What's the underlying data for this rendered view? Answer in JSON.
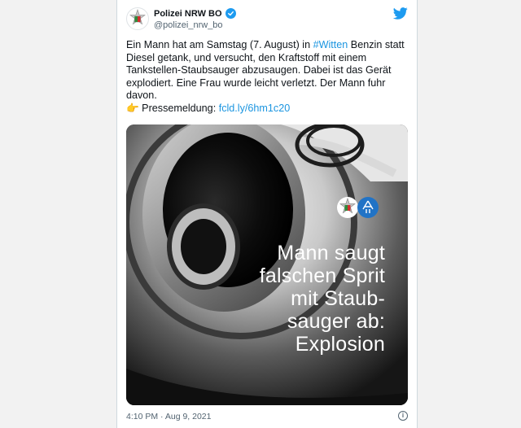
{
  "author": {
    "name": "Polizei NRW BO",
    "handle": "@polizei_nrw_bo"
  },
  "tweet": {
    "text_1": "Ein Mann hat am Samstag (7. August) in ",
    "hashtag": "#Witten",
    "text_2": " Benzin statt Diesel getank, und versucht, den Kraftstoff mit einem Tankstellen-Staubsauger abzusaugen. Dabei ist das Gerät explodiert. Eine Frau wurde leicht verletzt. Der Mann fuhr davon.",
    "pointer_emoji": "👉",
    "press_label": " Pressemeldung: ",
    "press_link": "fcld.ly/6hm1c20"
  },
  "media": {
    "title_lines": [
      "Mann saugt",
      "falschen Sprit",
      "mit Staub-",
      "sauger ab:",
      "Explosion"
    ]
  },
  "footer": {
    "timestamp": "4:10 PM · Aug 9, 2021"
  },
  "colors": {
    "accent": "#1d9bf0",
    "link": "#1b95e0",
    "police_blue": "#2173c6"
  },
  "icons": {
    "verified": "verified-badge-icon",
    "twitter": "twitter-bird-icon",
    "info": "info-icon",
    "police_star": "police-star-logo",
    "police_blue": "police-blue-logo"
  }
}
